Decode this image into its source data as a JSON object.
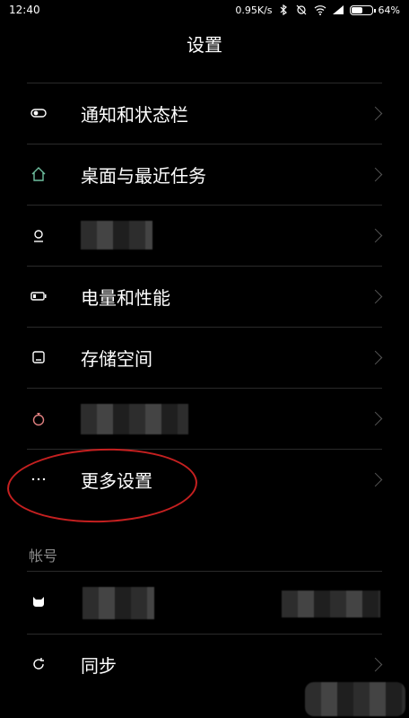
{
  "status": {
    "time": "12:40",
    "speed": "0.95K/s",
    "battery": "64%",
    "battery_level": 0.64
  },
  "header": {
    "title": "设置"
  },
  "items": [
    {
      "label": "通知和状态栏",
      "icon": "toggle-icon"
    },
    {
      "label": "桌面与最近任务",
      "icon": "home-icon"
    },
    {
      "label": "",
      "icon": "person-icon"
    },
    {
      "label": "电量和性能",
      "icon": "battery-icon"
    },
    {
      "label": "存储空间",
      "icon": "storage-icon"
    },
    {
      "label": "",
      "icon": "ring-icon"
    },
    {
      "label": "更多设置",
      "icon": "more-icon"
    }
  ],
  "account": {
    "section_label": "帐号",
    "sync_label": "同步"
  },
  "annotation": {
    "color": "#c52020"
  }
}
